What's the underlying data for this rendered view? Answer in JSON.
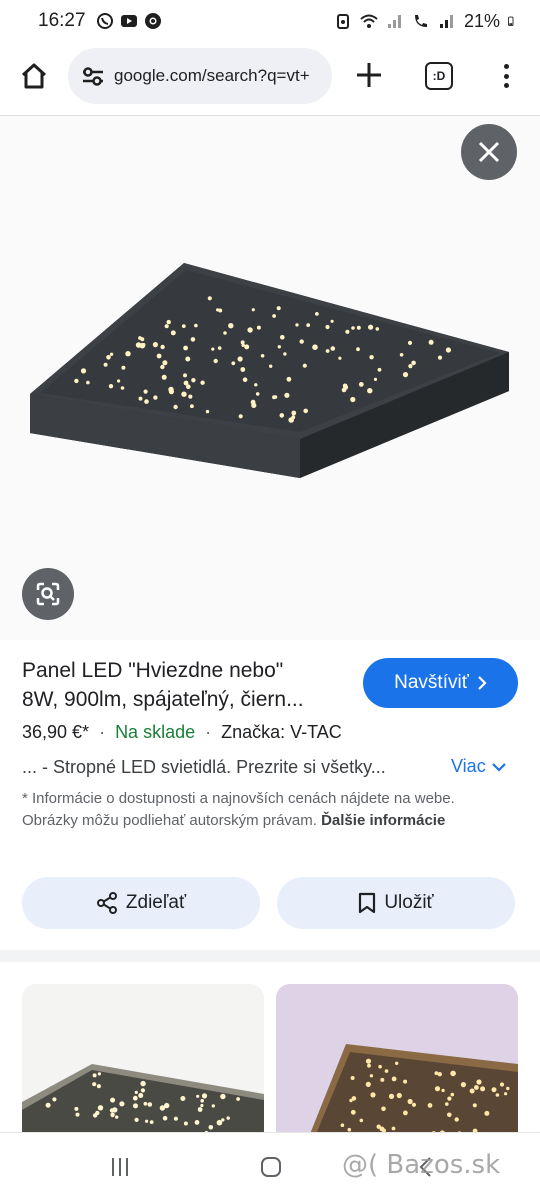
{
  "status": {
    "time": "16:27",
    "battery": "21%",
    "left_icons": [
      "whatsapp-icon",
      "youtube-icon",
      "chrome-icon"
    ],
    "right_icons": [
      "alarm-icon",
      "wifi-icon",
      "signal-icon",
      "wifi-call-icon",
      "signal-icon-2",
      "battery-icon"
    ]
  },
  "browser": {
    "url": "google.com/search?q=vt+",
    "tabs_label": ":D"
  },
  "product": {
    "title_line1": "Panel LED \"Hviezdne nebo\"",
    "title_line2": "8W, 900lm, spájateľný, čiern...",
    "visit_label": "Navštíviť",
    "price": "36,90 €*",
    "stock": "Na sklade",
    "brand": "Značka: V-TAC",
    "snippet": "... - Stropné LED svietidlá. Prezrite si všetky...",
    "more_label": "Viac",
    "disclaimer": "* Informácie o dostupnosti a najnovších cenách nájdete na webe. Obrázky môžu podliehať autorským právam.",
    "disclaimer_link": "Ďalšie informácie",
    "share_label": "Zdieľať",
    "save_label": "Uložiť"
  },
  "watermark": "@( Bazos.sk",
  "colors": {
    "accent": "#1a73e8",
    "stock_green": "#188038",
    "button_bg": "#e8effb"
  }
}
